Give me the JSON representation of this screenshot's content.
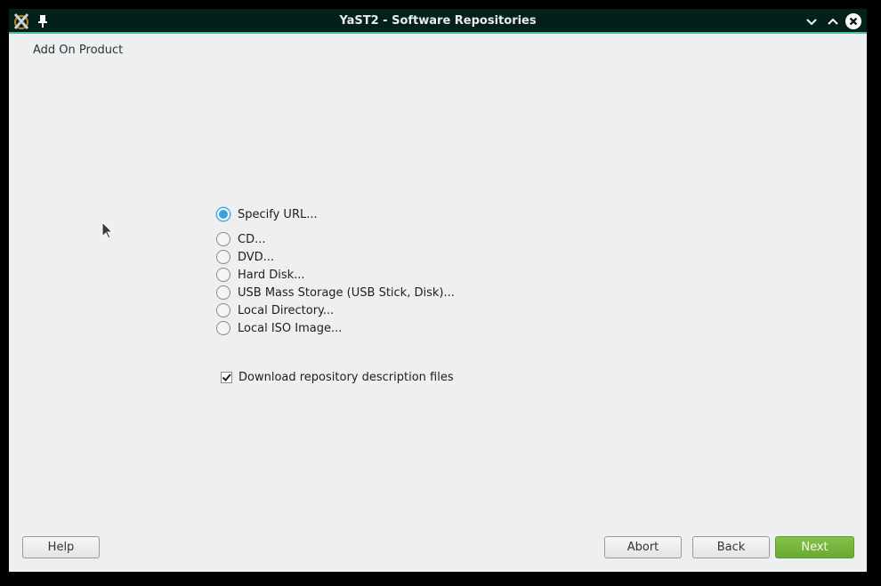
{
  "window": {
    "title": "YaST2 - Software Repositories",
    "icons": {
      "app": "yast-app-icon",
      "pin": "pin-icon",
      "minimize": "chevron-down-icon",
      "maximize": "chevron-up-icon",
      "close": "close-icon"
    }
  },
  "page": {
    "heading": "Add On Product"
  },
  "media_options": [
    {
      "label": "Specify URL...",
      "selected": true
    },
    {
      "label": "CD...",
      "selected": false
    },
    {
      "label": "DVD...",
      "selected": false
    },
    {
      "label": "Hard Disk...",
      "selected": false
    },
    {
      "label": "USB Mass Storage (USB Stick, Disk)...",
      "selected": false
    },
    {
      "label": "Local Directory...",
      "selected": false
    },
    {
      "label": "Local ISO Image...",
      "selected": false
    }
  ],
  "download_descriptions": {
    "label": "Download repository description files",
    "checked": true
  },
  "buttons": {
    "help": "Help",
    "abort": "Abort",
    "back": "Back",
    "next": "Next"
  },
  "colors": {
    "titlebar": "#04201a",
    "accent": "#4dbfa8",
    "radio_selected": "#3a9fdc",
    "next_button": "#78b53e"
  }
}
